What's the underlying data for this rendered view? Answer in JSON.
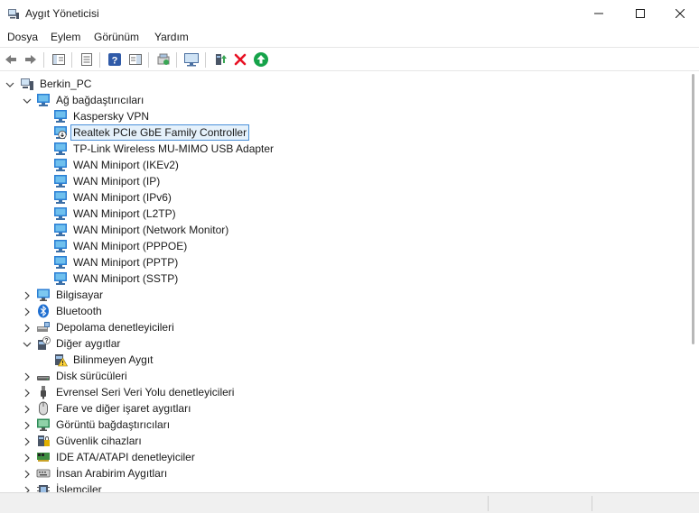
{
  "window": {
    "title": "Aygıt Yöneticisi"
  },
  "menu": [
    "Dosya",
    "Eylem",
    "Görünüm",
    "Yardım"
  ],
  "toolbar": [
    "back-icon",
    "forward-icon",
    "show-hide-tree-icon",
    "properties-icon",
    "help-icon",
    "action-pane-icon",
    "update-driver-icon",
    "scan-hardware-icon",
    "add-legacy-icon",
    "uninstall-icon",
    "enable-device-icon"
  ],
  "tree": {
    "root": "Berkin_PC",
    "network": {
      "label": "Ağ bağdaştırıcıları",
      "children": [
        "Kaspersky VPN",
        "Realtek PCIe GbE Family Controller",
        "TP-Link Wireless MU-MIMO USB Adapter",
        "WAN Miniport (IKEv2)",
        "WAN Miniport (IP)",
        "WAN Miniport (IPv6)",
        "WAN Miniport (L2TP)",
        "WAN Miniport (Network Monitor)",
        "WAN Miniport (PPPOE)",
        "WAN Miniport (PPTP)",
        "WAN Miniport (SSTP)"
      ]
    },
    "computer": "Bilgisayar",
    "bluetooth": "Bluetooth",
    "storage": "Depolama denetleyicileri",
    "other": {
      "label": "Diğer aygıtlar",
      "children": [
        "Bilinmeyen Aygıt"
      ]
    },
    "disk": "Disk sürücüleri",
    "usb": "Evrensel Seri Veri Yolu denetleyicileri",
    "mouse": "Fare ve diğer işaret aygıtları",
    "display": "Görüntü bağdaştırıcıları",
    "security": "Güvenlik cihazları",
    "ide": "IDE ATA/ATAPI denetleyiciler",
    "hid": "İnsan Arabirim Aygıtları",
    "processors": "İşlemciler"
  },
  "colors": {
    "selection": "#e5f1fb",
    "selection_border": "#4a90d9",
    "uninstall": "#e81123",
    "enable": "#16a34a"
  }
}
